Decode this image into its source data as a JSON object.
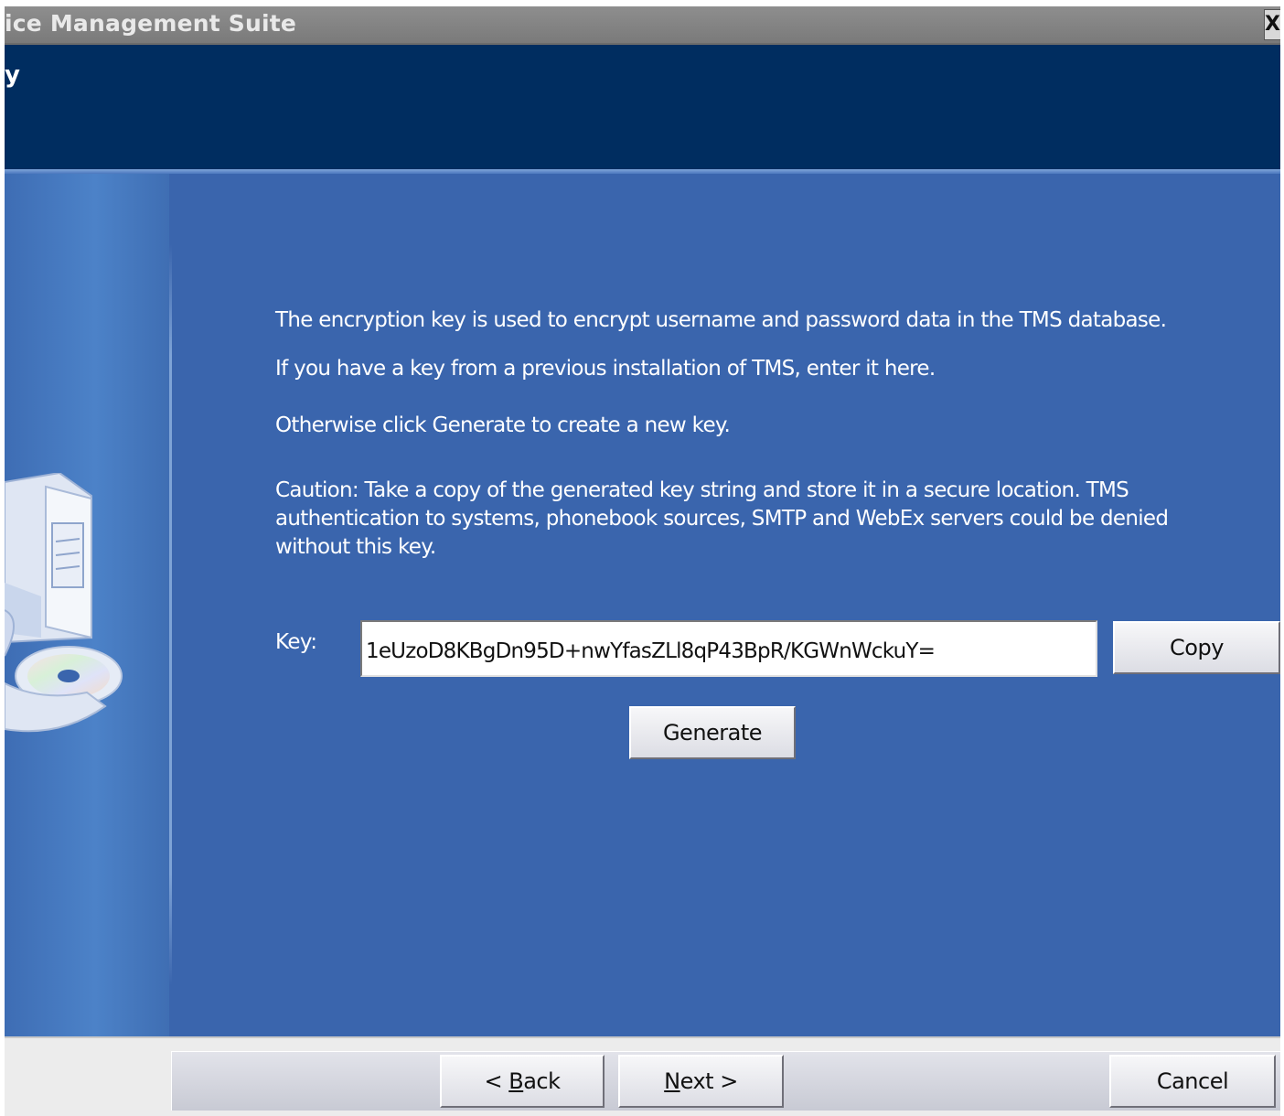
{
  "window": {
    "title": "ice Management Suite",
    "close_glyph": "X",
    "page_title": "y"
  },
  "main": {
    "intro_text": "The encryption key is used to encrypt username and password data in the TMS database.",
    "previous_key_text": "If you have a key from a previous installation of TMS, enter it here.",
    "generate_hint_text": "Otherwise click Generate to create a new key.",
    "caution_text": "Caution: Take a copy of the generated key string and store it in a secure location. TMS authentication to systems, phonebook sources, SMTP and WebEx servers could be denied without this key.",
    "key_label": "Key:",
    "key_value": "1eUzoD8KBgDn95D+nwYfasZLl8qP43BpR/KGWnWckuY=",
    "copy_label": "Copy",
    "generate_label": "Generate"
  },
  "footer": {
    "back_prefix": "< ",
    "back_accel": "B",
    "back_rest": "ack",
    "next_accel": "N",
    "next_rest": "ext >",
    "cancel_label": "Cancel"
  },
  "icons": [
    "computer-tower-icon",
    "cd-disc-icon",
    "close-icon"
  ],
  "colors": {
    "title_bar": "#7a7a7a",
    "header_bg": "#002d60",
    "body_bg": "#3a65ad",
    "button_face": "#e4e5eb"
  }
}
